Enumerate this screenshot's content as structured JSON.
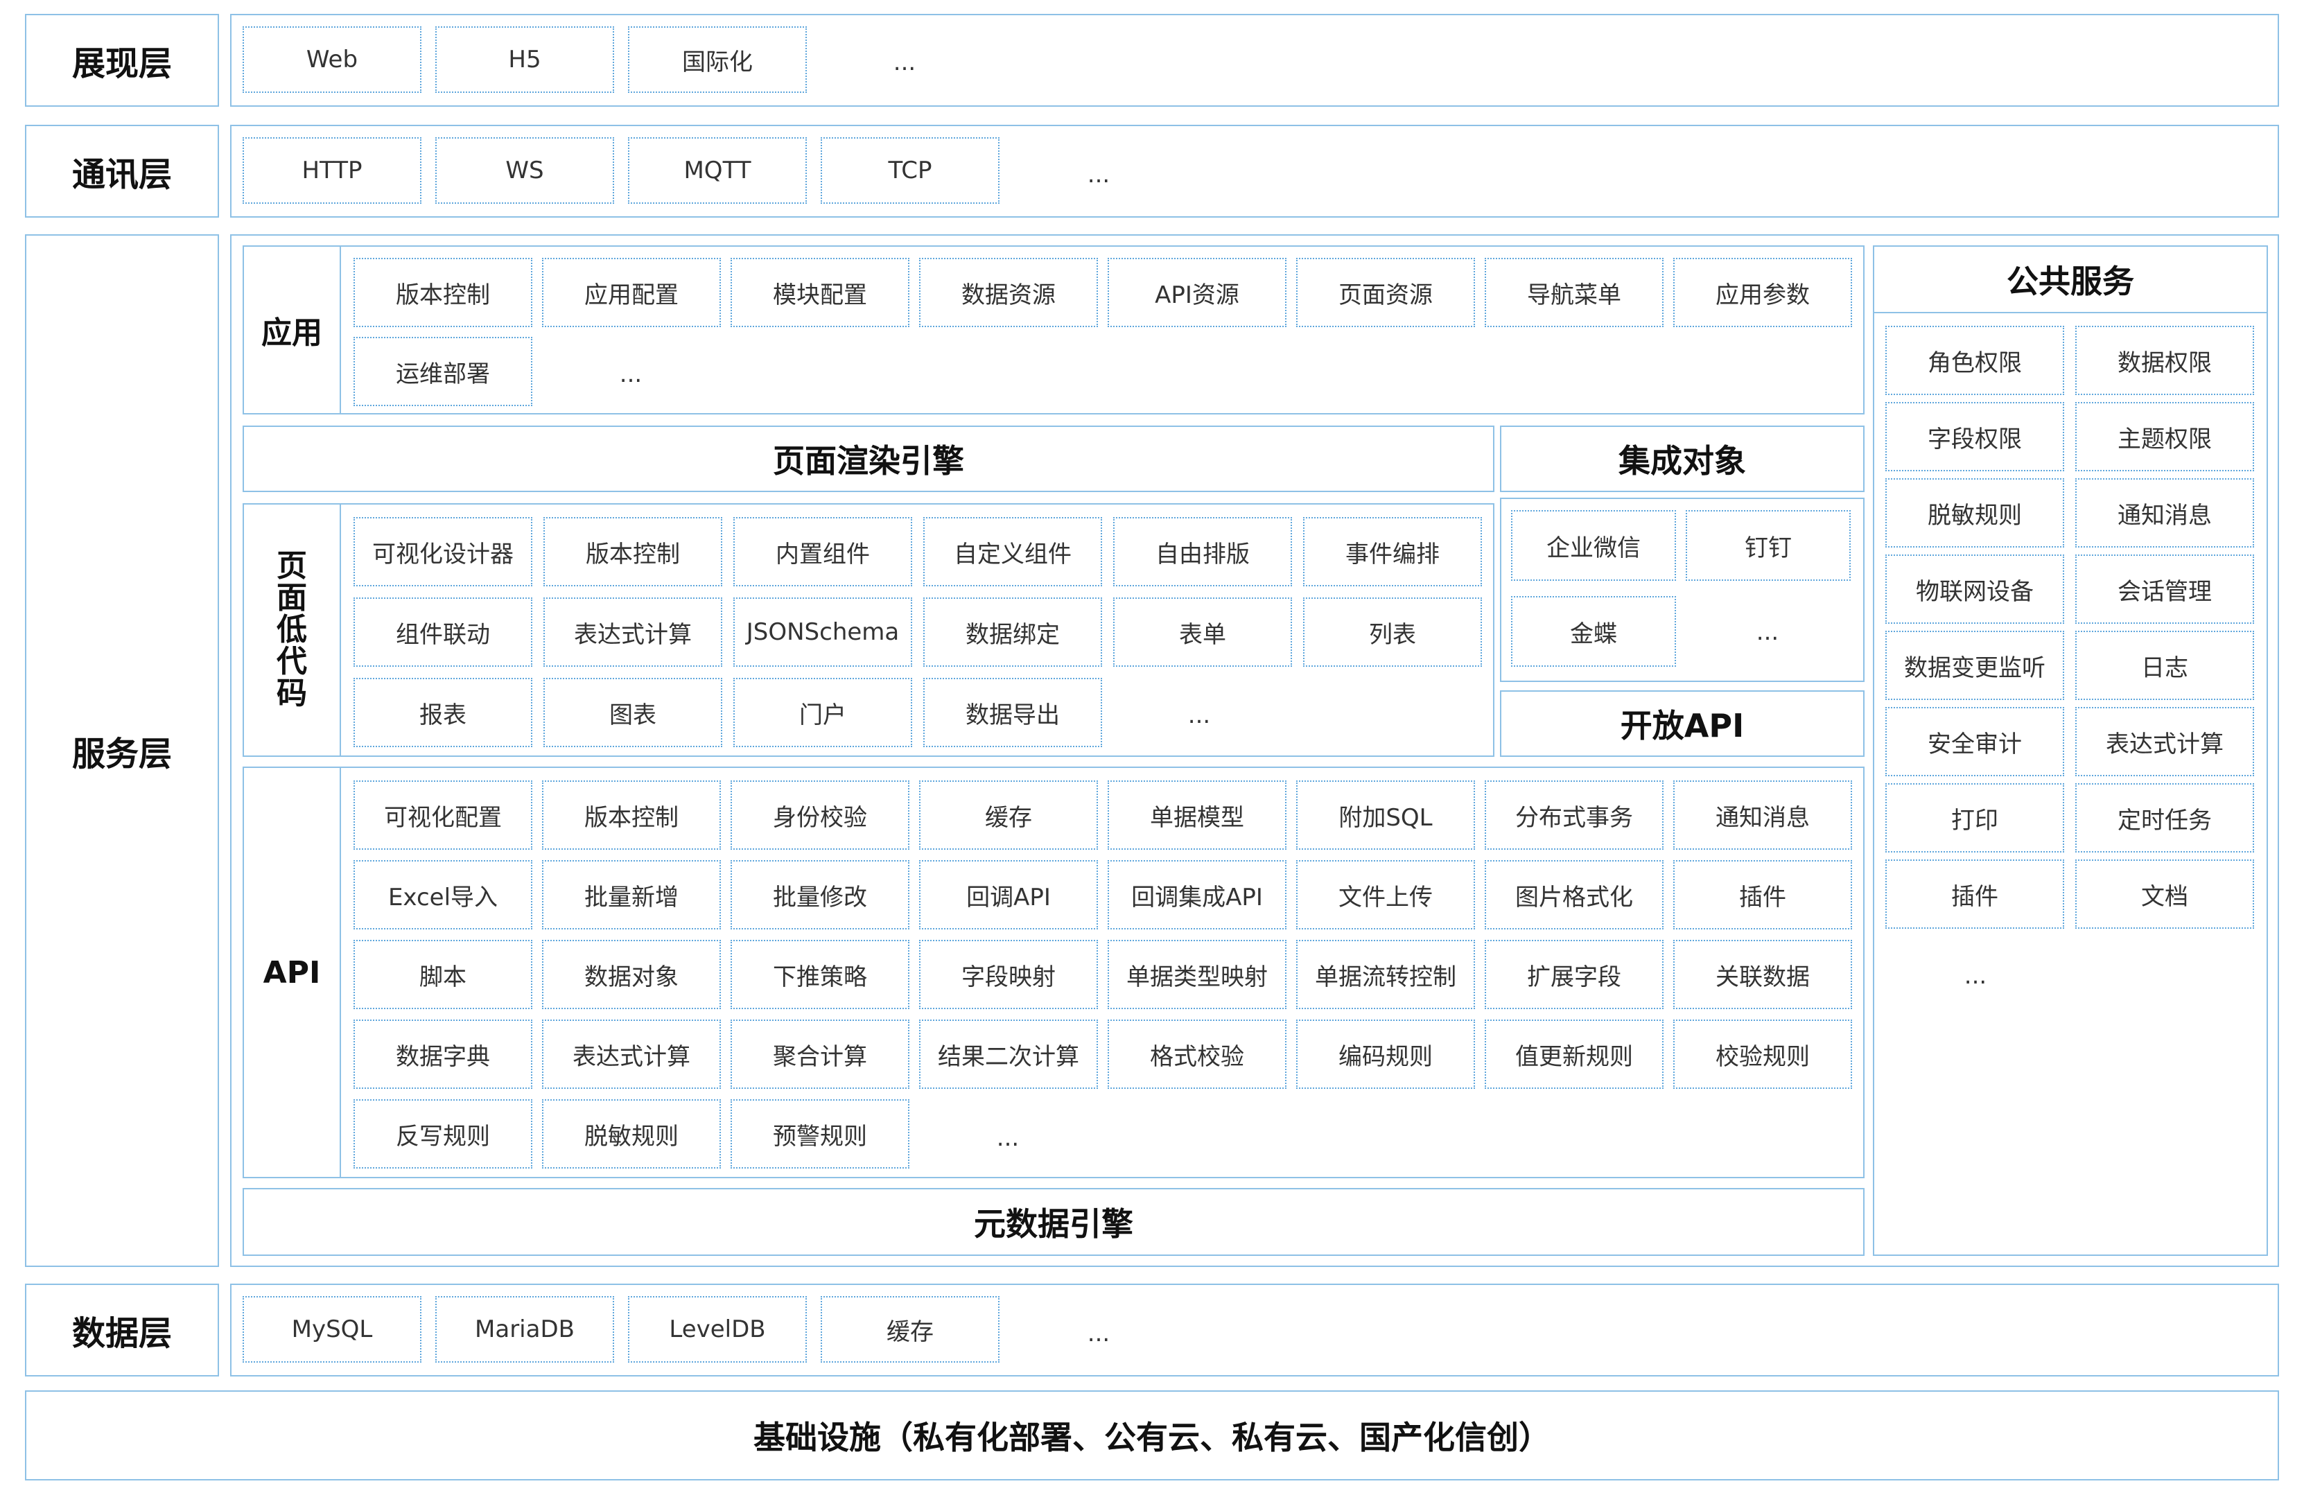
{
  "layers": {
    "presentation": "展现层",
    "communication": "通讯层",
    "service": "服务层",
    "data": "数据层"
  },
  "presentation_items": [
    "Web",
    "H5",
    "国际化"
  ],
  "communication_items": [
    "HTTP",
    "WS",
    "MQTT",
    "TCP"
  ],
  "data_items": [
    "MySQL",
    "MariaDB",
    "LevelDB",
    "缓存"
  ],
  "ellipsis": "...",
  "app": {
    "label": "应用",
    "items": [
      "版本控制",
      "应用配置",
      "模块配置",
      "数据资源",
      "API资源",
      "页面资源",
      "导航菜单",
      "应用参数",
      "运维部署"
    ]
  },
  "render_engine": "页面渲染引擎",
  "lowcode": {
    "label_chars": [
      "页",
      "面",
      "低",
      "代",
      "码"
    ],
    "items": [
      "可视化设计器",
      "版本控制",
      "内置组件",
      "自定义组件",
      "自由排版",
      "事件编排",
      "组件联动",
      "表达式计算",
      "JSONSchema",
      "数据绑定",
      "表单",
      "列表",
      "报表",
      "图表",
      "门户",
      "数据导出"
    ]
  },
  "integration": {
    "title": "集成对象",
    "items": [
      "企业微信",
      "钉钉",
      "金蝶"
    ]
  },
  "open_api": "开放API",
  "api": {
    "label": "API",
    "items": [
      "可视化配置",
      "版本控制",
      "身份校验",
      "缓存",
      "单据模型",
      "附加SQL",
      "分布式事务",
      "通知消息",
      "Excel导入",
      "批量新增",
      "批量修改",
      "回调API",
      "回调集成API",
      "文件上传",
      "图片格式化",
      "插件",
      "脚本",
      "数据对象",
      "下推策略",
      "字段映射",
      "单据类型映射",
      "单据流转控制",
      "扩展字段",
      "关联数据",
      "数据字典",
      "表达式计算",
      "聚合计算",
      "结果二次计算",
      "格式校验",
      "编码规则",
      "值更新规则",
      "校验规则",
      "反写规则",
      "脱敏规则",
      "预警规则"
    ]
  },
  "metadata_engine": "元数据引擎",
  "public_services": {
    "title": "公共服务",
    "items": [
      "角色权限",
      "数据权限",
      "字段权限",
      "主题权限",
      "脱敏规则",
      "通知消息",
      "物联网设备",
      "会话管理",
      "数据变更监听",
      "日志",
      "安全审计",
      "表达式计算",
      "打印",
      "定时任务",
      "插件",
      "文档"
    ]
  },
  "infrastructure": "基础设施（私有化部署、公有云、私有云、国产化信创）"
}
